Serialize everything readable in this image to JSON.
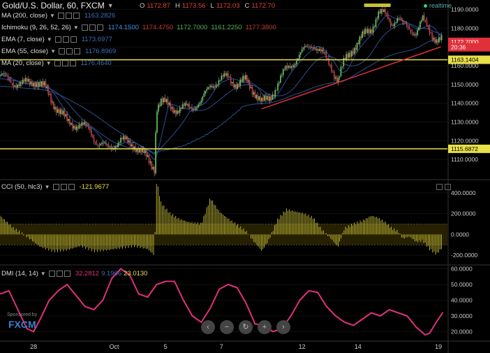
{
  "header": {
    "title": "Gold/U.S. Dollar, 60, FXCM",
    "ohlc": [
      {
        "k": "O",
        "v": "1172.87"
      },
      {
        "k": "H",
        "v": "1173.56"
      },
      {
        "k": "L",
        "v": "1172.03"
      },
      {
        "k": "C",
        "v": "1172.70"
      }
    ],
    "realtime": "realtime"
  },
  "indicators": [
    {
      "label": "MA (200, close)",
      "values": [
        {
          "v": "1163.2826",
          "color": "#3b6fb5"
        }
      ]
    },
    {
      "label": "Ichimoku (9, 26, 52, 26)",
      "values": [
        {
          "v": "1174.1500",
          "color": "#3b8ee0"
        },
        {
          "v": "1174.4750",
          "color": "#c0392b"
        },
        {
          "v": "1172.7000",
          "color": "#4caf50"
        },
        {
          "v": "1161.2250",
          "color": "#4caf50"
        },
        {
          "v": "1177.3800",
          "color": "#c0392b"
        }
      ]
    },
    {
      "label": "EMA (7, close)",
      "values": [
        {
          "v": "1173.6977",
          "color": "#3b6fb5"
        }
      ]
    },
    {
      "label": "EMA (55, close)",
      "values": [
        {
          "v": "1176.8969",
          "color": "#3b6fb5"
        }
      ]
    },
    {
      "label": "MA (20, close)",
      "values": [
        {
          "v": "1176.4640",
          "color": "#3b6fb5"
        }
      ]
    }
  ],
  "cci": {
    "label": "CCI (50, hlc3)",
    "value": "-121.9677",
    "value_color": "#e8e04a"
  },
  "dmi": {
    "label": "DMI (14, 14)",
    "values": [
      {
        "v": "32.2812",
        "color": "#e0307a"
      },
      {
        "v": "9.1966",
        "color": "#3b6fb5"
      },
      {
        "v": "23.0130",
        "color": "#e8e04a"
      }
    ]
  },
  "sponsor": {
    "text": "Sponsored by",
    "brand": "FXCM"
  },
  "nav_buttons": [
    "‹",
    "−",
    "↻",
    "+",
    "›"
  ],
  "chart_data": [
    {
      "type": "candlestick",
      "title": "Gold/U.S. Dollar, 60, FXCM",
      "ylim": [
        1100,
        1195
      ],
      "yticks": [
        1110,
        1120,
        1130,
        1140,
        1150,
        1160,
        1170,
        1180,
        1190
      ],
      "ytick_labels": [
        "1110.0000",
        "1120.0000",
        "1130.0000",
        "1140.0000",
        "1150.0000",
        "1160.0000",
        "1170.0000",
        "1180.0000",
        "1190.0000"
      ],
      "price_labels": [
        {
          "v": "1172.7000",
          "value": 1172.7,
          "color": "#e0303a"
        },
        {
          "v": "20:36",
          "value": 1169.8,
          "color": "#e0303a"
        },
        {
          "v": "1163.1404",
          "value": 1163.14,
          "color": "#e8e04a"
        },
        {
          "v": "1115.6872",
          "value": 1115.69,
          "color": "#e8e04a"
        }
      ],
      "hlines": [
        1163.14,
        1115.69
      ],
      "trendline": [
        {
          "t": 0.585,
          "y": 1137
        },
        {
          "t": 0.985,
          "y": 1170
        }
      ],
      "xticks": [
        {
          "t": 0.075,
          "label": "28"
        },
        {
          "t": 0.255,
          "label": "Oct"
        },
        {
          "t": 0.37,
          "label": "5"
        },
        {
          "t": 0.495,
          "label": "7"
        },
        {
          "t": 0.675,
          "label": "12"
        },
        {
          "t": 0.8,
          "label": "14"
        },
        {
          "t": 0.98,
          "label": "19"
        }
      ],
      "path": [
        [
          0.0,
          1155
        ],
        [
          0.02,
          1152
        ],
        [
          0.05,
          1150
        ],
        [
          0.08,
          1152
        ],
        [
          0.1,
          1148
        ],
        [
          0.12,
          1140
        ],
        [
          0.15,
          1130
        ],
        [
          0.18,
          1128
        ],
        [
          0.2,
          1126
        ],
        [
          0.22,
          1118
        ],
        [
          0.24,
          1116
        ],
        [
          0.27,
          1120
        ],
        [
          0.3,
          1118
        ],
        [
          0.33,
          1110
        ],
        [
          0.345,
          1106
        ],
        [
          0.35,
          1138
        ],
        [
          0.36,
          1140
        ],
        [
          0.38,
          1139
        ],
        [
          0.4,
          1136
        ],
        [
          0.42,
          1138
        ],
        [
          0.45,
          1140
        ],
        [
          0.47,
          1150
        ],
        [
          0.49,
          1152
        ],
        [
          0.51,
          1154
        ],
        [
          0.53,
          1150
        ],
        [
          0.55,
          1152
        ],
        [
          0.57,
          1146
        ],
        [
          0.585,
          1140
        ],
        [
          0.6,
          1142
        ],
        [
          0.62,
          1150
        ],
        [
          0.64,
          1158
        ],
        [
          0.66,
          1163
        ],
        [
          0.68,
          1168
        ],
        [
          0.7,
          1172
        ],
        [
          0.72,
          1166
        ],
        [
          0.74,
          1160
        ],
        [
          0.755,
          1152
        ],
        [
          0.77,
          1162
        ],
        [
          0.79,
          1170
        ],
        [
          0.81,
          1175
        ],
        [
          0.83,
          1180
        ],
        [
          0.845,
          1188
        ],
        [
          0.86,
          1187
        ],
        [
          0.875,
          1183
        ],
        [
          0.89,
          1186
        ],
        [
          0.9,
          1181
        ],
        [
          0.915,
          1180
        ],
        [
          0.93,
          1178
        ],
        [
          0.945,
          1184
        ],
        [
          0.96,
          1179
        ],
        [
          0.975,
          1174
        ],
        [
          0.99,
          1173
        ]
      ]
    },
    {
      "type": "bar",
      "title": "CCI (50, hlc3)",
      "ylim": [
        -300,
        520
      ],
      "yticks": [
        -200,
        0,
        200,
        400
      ],
      "ytick_labels": [
        "-200.0000",
        "0.0000",
        "200.0000",
        "400.0000"
      ],
      "dashed_levels": [
        100,
        -100
      ],
      "path": [
        [
          0.0,
          180
        ],
        [
          0.03,
          60
        ],
        [
          0.06,
          -20
        ],
        [
          0.09,
          -120
        ],
        [
          0.12,
          -160
        ],
        [
          0.15,
          -150
        ],
        [
          0.18,
          -110
        ],
        [
          0.21,
          -160
        ],
        [
          0.24,
          -150
        ],
        [
          0.27,
          -130
        ],
        [
          0.3,
          -110
        ],
        [
          0.33,
          -140
        ],
        [
          0.345,
          -200
        ],
        [
          0.35,
          520
        ],
        [
          0.36,
          300
        ],
        [
          0.38,
          200
        ],
        [
          0.4,
          150
        ],
        [
          0.42,
          120
        ],
        [
          0.45,
          100
        ],
        [
          0.47,
          350
        ],
        [
          0.49,
          220
        ],
        [
          0.51,
          150
        ],
        [
          0.53,
          90
        ],
        [
          0.55,
          30
        ],
        [
          0.57,
          -80
        ],
        [
          0.585,
          -160
        ],
        [
          0.6,
          -60
        ],
        [
          0.62,
          140
        ],
        [
          0.64,
          240
        ],
        [
          0.66,
          220
        ],
        [
          0.68,
          200
        ],
        [
          0.7,
          160
        ],
        [
          0.72,
          40
        ],
        [
          0.74,
          -40
        ],
        [
          0.755,
          -120
        ],
        [
          0.77,
          60
        ],
        [
          0.79,
          100
        ],
        [
          0.81,
          130
        ],
        [
          0.83,
          180
        ],
        [
          0.845,
          160
        ],
        [
          0.86,
          120
        ],
        [
          0.875,
          60
        ],
        [
          0.89,
          30
        ],
        [
          0.9,
          -40
        ],
        [
          0.915,
          -20
        ],
        [
          0.93,
          -70
        ],
        [
          0.945,
          -60
        ],
        [
          0.96,
          -140
        ],
        [
          0.975,
          -190
        ],
        [
          0.99,
          -122
        ]
      ]
    },
    {
      "type": "line",
      "title": "DMI (14, 14)",
      "ylim": [
        14,
        62
      ],
      "yticks": [
        20,
        30,
        40,
        50,
        60
      ],
      "ytick_labels": [
        "20.0000",
        "30.0000",
        "40.0000",
        "50.0000",
        "60.0000"
      ],
      "series": [
        {
          "color": "#e0307a",
          "points": [
            [
              0.0,
              44
            ],
            [
              0.02,
              46
            ],
            [
              0.04,
              34
            ],
            [
              0.06,
              22
            ],
            [
              0.075,
              20
            ],
            [
              0.09,
              28
            ],
            [
              0.11,
              40
            ],
            [
              0.13,
              46
            ],
            [
              0.15,
              50
            ],
            [
              0.17,
              43
            ],
            [
              0.19,
              36
            ],
            [
              0.21,
              34
            ],
            [
              0.23,
              40
            ],
            [
              0.25,
              54
            ],
            [
              0.27,
              60
            ],
            [
              0.29,
              56
            ],
            [
              0.31,
              44
            ],
            [
              0.33,
              42
            ],
            [
              0.35,
              50
            ],
            [
              0.37,
              52
            ],
            [
              0.39,
              52
            ],
            [
              0.41,
              40
            ],
            [
              0.43,
              30
            ],
            [
              0.45,
              26
            ],
            [
              0.47,
              35
            ],
            [
              0.49,
              47
            ],
            [
              0.51,
              50
            ],
            [
              0.53,
              48
            ],
            [
              0.55,
              38
            ],
            [
              0.57,
              25
            ],
            [
              0.59,
              24
            ],
            [
              0.61,
              20
            ],
            [
              0.63,
              22
            ],
            [
              0.65,
              30
            ],
            [
              0.67,
              40
            ],
            [
              0.69,
              46
            ],
            [
              0.71,
              45
            ],
            [
              0.73,
              36
            ],
            [
              0.75,
              30
            ],
            [
              0.77,
              26
            ],
            [
              0.79,
              24
            ],
            [
              0.81,
              28
            ],
            [
              0.83,
              32
            ],
            [
              0.85,
              30
            ],
            [
              0.87,
              34
            ],
            [
              0.89,
              32
            ],
            [
              0.91,
              30
            ],
            [
              0.93,
              23
            ],
            [
              0.95,
              18
            ],
            [
              0.96,
              19
            ],
            [
              0.975,
              26
            ],
            [
              0.99,
              32.3
            ]
          ]
        }
      ]
    }
  ]
}
